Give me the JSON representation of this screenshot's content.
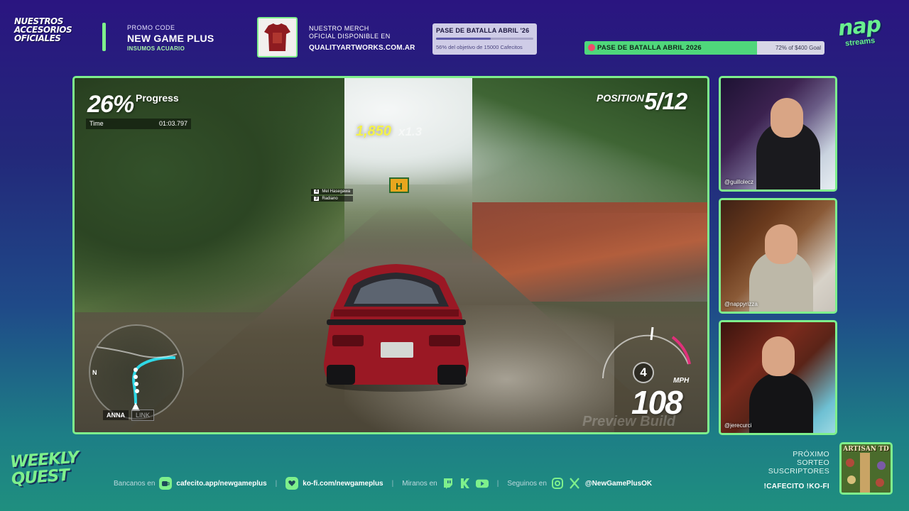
{
  "header": {
    "accessories_title": "NUESTROS ACCESORIOS OFICIALES",
    "promo": {
      "label": "PROMO CODE",
      "code": "NEW GAME PLUS",
      "sub": "INSUMOS ACUARIO"
    },
    "merch": {
      "line1": "NUESTRO MERCH",
      "line2": "OFICIAL DISPONIBLE EN",
      "url": "QUALITYARTWORKS.COM.AR"
    },
    "goal_small": {
      "title": "PASE DE BATALLA ABRIL '26",
      "progress_fraction": 0.56,
      "subtitle": "56% del objetivo de 15000 Cafecitos"
    },
    "goal_large": {
      "title": "PASE DE BATALLA ABRIL 2026",
      "progress_fraction": 0.72,
      "right_text": "72% of $400 Goal"
    },
    "brand_logo": {
      "name": "nap",
      "tagline": "streams"
    }
  },
  "game": {
    "progress_value": "26%",
    "progress_label": "Progress",
    "time_label": "Time",
    "time_value": "01:03.797",
    "position_label": "POSITION",
    "position_value": "5/12",
    "score": "1,850",
    "multiplier": "x1.3",
    "racer_tags": [
      {
        "num": "4",
        "name": "Mel Hasegawa"
      },
      {
        "num": "3",
        "name": "Radiano"
      }
    ],
    "minimap_north": "N",
    "player_name": "ANNA",
    "link_label": "LINK",
    "gear": "4",
    "speed": "108",
    "speed_unit": "MPH",
    "watermark": "Preview Build"
  },
  "cams": [
    {
      "handle": "@guillolecz"
    },
    {
      "handle": "@nappyrizza"
    },
    {
      "handle": "@jerecurci"
    }
  ],
  "footer": {
    "show_logo": "WEEKLY QUEST",
    "bancanos_label": "Bancanos en",
    "cafecito": "cafecito.app/newgameplus",
    "kofi": "ko-fi.com/newgameplus",
    "miranos_label": "Miranos en",
    "seguinos_label": "Seguinos en",
    "handle": "@NewGamePlusOK",
    "sorteo_lines": [
      "PRÓXIMO",
      "SORTEO",
      "SUSCRIPTORES"
    ],
    "sorteo_cmds": "!CAFECITO !KO-FI",
    "artisan_title": "ARTISAN TD"
  },
  "colors": {
    "accent_green": "#7ef08c",
    "score_yellow": "#f4f24a",
    "bg_top": "#2a1580",
    "bg_bottom": "#1f8f7f"
  }
}
